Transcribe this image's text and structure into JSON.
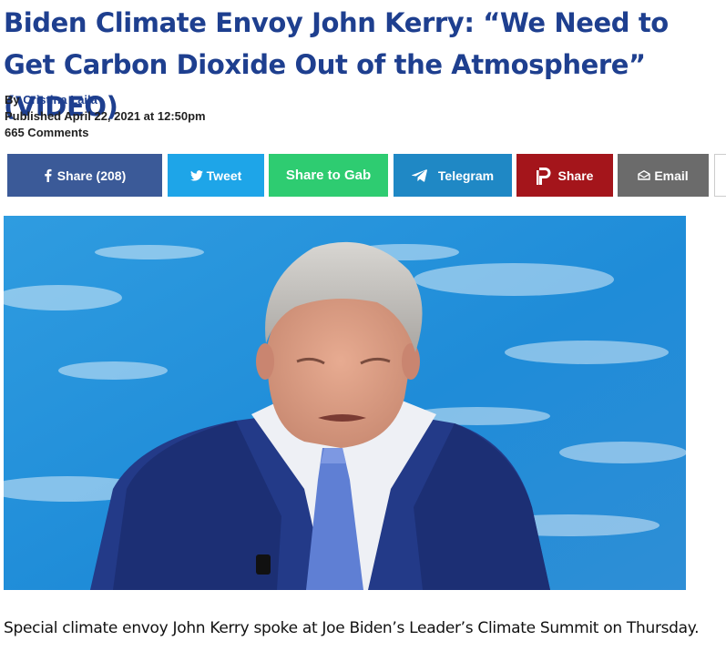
{
  "article": {
    "headline": "Biden Climate Envoy John Kerry: “We Need to Get Carbon Dioxide Out of the Atmosphere” (VIDEO)",
    "byline_prefix": "By",
    "author": "Cristina Laila",
    "published": "Published April 22, 2021 at 12:50pm",
    "comments": "665 Comments",
    "body_first_paragraph": "Special climate envoy John Kerry spoke at Joe Biden’s Leader’s Climate Summit on Thursday."
  },
  "share": {
    "facebook_label": "Share (208)",
    "twitter_label": "Tweet",
    "gab_label": "Share to Gab",
    "telegram_label": "Telegram",
    "parler_label": "Share",
    "email_label": "Email"
  },
  "icons": {
    "facebook": "facebook-icon",
    "twitter": "twitter-icon",
    "telegram": "telegram-icon",
    "parler": "parler-icon",
    "email": "email-icon"
  },
  "colors": {
    "headline": "#1e3f8f",
    "facebook": "#3b5a98",
    "twitter": "#1ea5e8",
    "gab": "#2ecc71",
    "telegram": "#1f88c5",
    "parler": "#a4151b",
    "email": "#6b6b6b"
  }
}
